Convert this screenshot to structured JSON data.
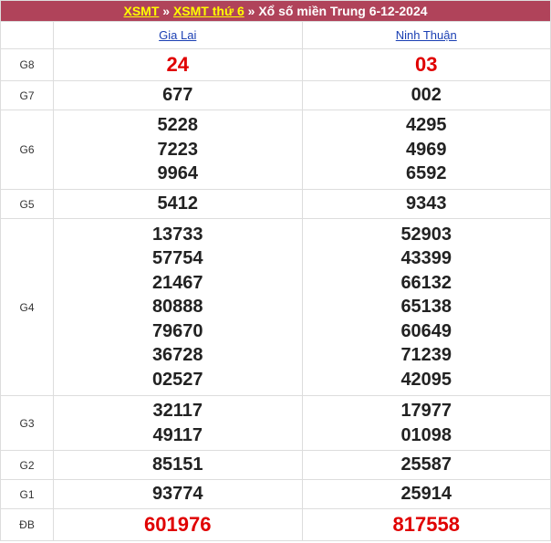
{
  "header": {
    "link1": "XSMT",
    "sep1": "»",
    "link2": "XSMT thứ 6",
    "sep2": "»",
    "text": "Xổ số miền Trung 6-12-2024"
  },
  "provinces": [
    "Gia Lai",
    "Ninh Thuận"
  ],
  "prizes": [
    {
      "label": "G8",
      "values": [
        [
          "24"
        ],
        [
          "03"
        ]
      ]
    },
    {
      "label": "G7",
      "values": [
        [
          "677"
        ],
        [
          "002"
        ]
      ]
    },
    {
      "label": "G6",
      "values": [
        [
          "5228",
          "7223",
          "9964"
        ],
        [
          "4295",
          "4969",
          "6592"
        ]
      ]
    },
    {
      "label": "G5",
      "values": [
        [
          "5412"
        ],
        [
          "9343"
        ]
      ]
    },
    {
      "label": "G4",
      "values": [
        [
          "13733",
          "57754",
          "21467",
          "80888",
          "79670",
          "36728",
          "02527"
        ],
        [
          "52903",
          "43399",
          "66132",
          "65138",
          "60649",
          "71239",
          "42095"
        ]
      ]
    },
    {
      "label": "G3",
      "values": [
        [
          "32117",
          "49117"
        ],
        [
          "17977",
          "01098"
        ]
      ]
    },
    {
      "label": "G2",
      "values": [
        [
          "85151"
        ],
        [
          "25587"
        ]
      ]
    },
    {
      "label": "G1",
      "values": [
        [
          "93774"
        ],
        [
          "25914"
        ]
      ]
    },
    {
      "label": "ĐB",
      "values": [
        [
          "601976"
        ],
        [
          "817558"
        ]
      ]
    }
  ],
  "colors": {
    "header_bg": "#b0435a",
    "header_link": "#ffff00",
    "special_number": "#e00000",
    "province_link": "#1a3fb3"
  }
}
